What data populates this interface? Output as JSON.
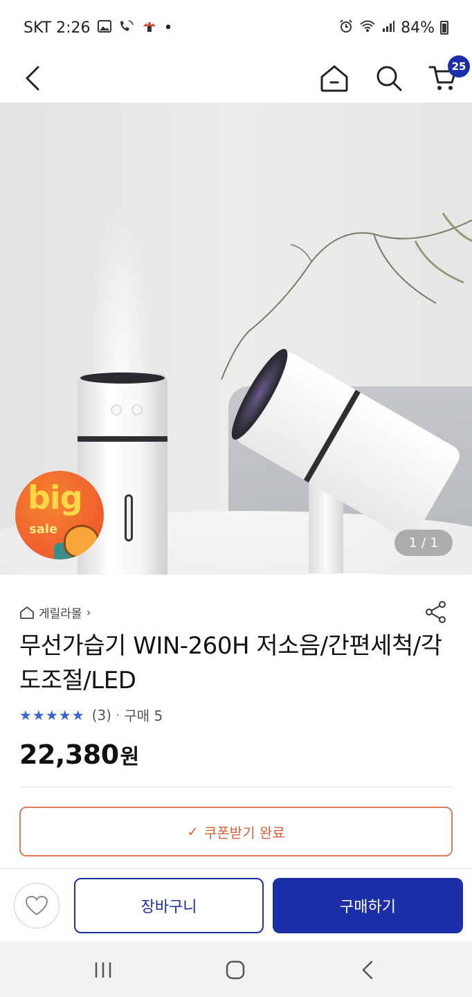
{
  "status_bar": {
    "carrier_time": "SKT 2:26",
    "dot": "•",
    "battery": "84%",
    "icons": [
      "image-icon",
      "phone-wifi-call-icon",
      "mushroom-icon",
      "alarm-icon",
      "wifi-icon",
      "signal-icon",
      "battery-icon"
    ]
  },
  "header": {
    "icons": [
      "back-icon",
      "home-icon",
      "search-icon",
      "cart-icon"
    ],
    "cart_count": "25"
  },
  "product_image": {
    "counter": "1 / 1",
    "sale_badge_big": "big",
    "sale_badge_small": "sale"
  },
  "product": {
    "store_name": "게릴라몰",
    "store_chevron": "›",
    "title": "무선가습기 WIN-260H 저소음/간편세척/각도조절/LED",
    "rating_stars": "★★★★★",
    "rating": 4.5,
    "review_count": "(3)",
    "separator": "·",
    "purchase_count": "구매 5",
    "price": "22,380",
    "price_unit": "원"
  },
  "coupon": {
    "check_icon": "✓",
    "label": "쿠폰받기 완료",
    "accent": "#d9603a"
  },
  "bottom_bar": {
    "add_to_cart": "장바구니",
    "buy_now": "구매하기",
    "brand_color": "#1c2fa8"
  },
  "nav_bar": {
    "icons": [
      "recent-apps-icon",
      "home-circle-icon",
      "back-chevron-icon"
    ]
  }
}
